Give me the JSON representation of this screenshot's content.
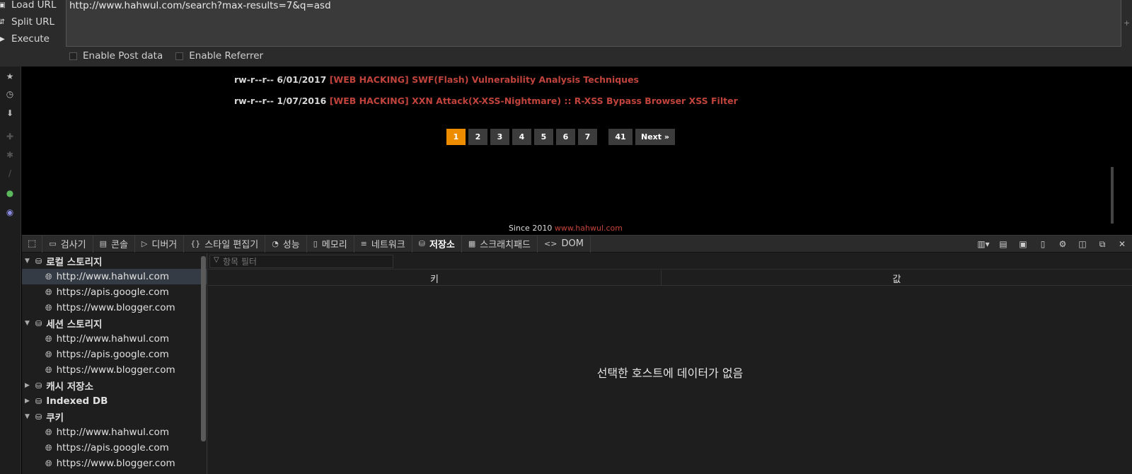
{
  "hackbar": {
    "buttons": [
      {
        "label": "Load URL",
        "icon": "load-icon"
      },
      {
        "label": "Split URL",
        "icon": "split-icon"
      },
      {
        "label": "Execute",
        "icon": "execute-icon"
      }
    ],
    "url_value": "http://www.hahwul.com/search?max-results=7&q=asd",
    "options": [
      {
        "label": "Enable Post data",
        "checked": false
      },
      {
        "label": "Enable Referrer",
        "checked": false
      }
    ]
  },
  "page": {
    "posts": [
      {
        "perm": "rw-r--r--",
        "date": "6/01/2017",
        "title": "[WEB HACKING] SWF(Flash) Vulnerability Analysis Techniques"
      },
      {
        "perm": "rw-r--r--",
        "date": "1/07/2016",
        "title": "[WEB HACKING] XXN Attack(X-XSS-Nightmare) :: R-XSS Bypass Browser XSS Filter"
      }
    ],
    "pagination": [
      "1",
      "2",
      "3",
      "4",
      "5",
      "6",
      "7",
      "41",
      "Next »"
    ],
    "active_page": "1",
    "footer_text": "Since 2010",
    "footer_link": "www.hahwul.com",
    "link_color": "#c0433c",
    "active_color": "#ee8c00"
  },
  "devtools": {
    "tabs": [
      {
        "label": "검사기",
        "icon": "inspector-icon"
      },
      {
        "label": "콘솔",
        "icon": "console-icon"
      },
      {
        "label": "디버거",
        "icon": "debugger-icon"
      },
      {
        "label": "스타일 편집기",
        "icon": "style-editor-icon"
      },
      {
        "label": "성능",
        "icon": "performance-icon"
      },
      {
        "label": "메모리",
        "icon": "memory-icon"
      },
      {
        "label": "네트워크",
        "icon": "network-icon"
      },
      {
        "label": "저장소",
        "icon": "storage-icon",
        "selected": true
      },
      {
        "label": "스크래치패드",
        "icon": "scratchpad-icon"
      },
      {
        "label": "DOM",
        "icon": "dom-icon"
      }
    ],
    "storage_tree": [
      {
        "label": "로컬 스토리지",
        "expanded": true,
        "hosts": [
          "http://www.hahwul.com",
          "https://apis.google.com",
          "https://www.blogger.com"
        ]
      },
      {
        "label": "세션 스토리지",
        "expanded": true,
        "hosts": [
          "http://www.hahwul.com",
          "https://apis.google.com",
          "https://www.blogger.com"
        ]
      },
      {
        "label": "캐시 저장소",
        "expanded": false,
        "hosts": []
      },
      {
        "label": "Indexed DB",
        "expanded": false,
        "hosts": []
      },
      {
        "label": "쿠키",
        "expanded": true,
        "hosts": [
          "http://www.hahwul.com",
          "https://apis.google.com",
          "https://www.blogger.com"
        ]
      }
    ],
    "selected_host": "http://www.hahwul.com",
    "filter_placeholder": "항목 필터",
    "columns": {
      "key": "키",
      "value": "값"
    },
    "empty_message": "선택한 호스트에 데이터가 없음"
  }
}
